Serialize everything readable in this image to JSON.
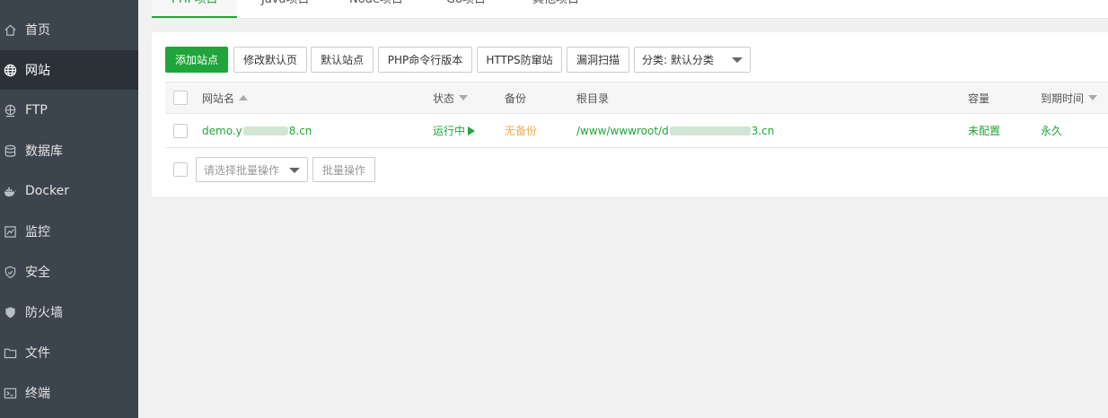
{
  "sidebar": {
    "items": [
      {
        "label": "首页",
        "icon": "home-icon"
      },
      {
        "label": "网站",
        "icon": "globe-icon"
      },
      {
        "label": "FTP",
        "icon": "ftp-icon"
      },
      {
        "label": "数据库",
        "icon": "database-icon"
      },
      {
        "label": "Docker",
        "icon": "docker-icon"
      },
      {
        "label": "监控",
        "icon": "monitor-icon"
      },
      {
        "label": "安全",
        "icon": "shield-check-icon"
      },
      {
        "label": "防火墙",
        "icon": "firewall-icon"
      },
      {
        "label": "文件",
        "icon": "folder-icon"
      },
      {
        "label": "终端",
        "icon": "terminal-icon"
      }
    ],
    "active_index": 1
  },
  "tabs": [
    "PHP项目",
    "Java项目",
    "Node项目",
    "Go项目",
    "其他项目"
  ],
  "toolbar": {
    "add_site": "添加站点",
    "edit_default_page": "修改默认页",
    "default_site": "默认站点",
    "php_cli_version": "PHP命令行版本",
    "https_anti_cross": "HTTPS防窜站",
    "vuln_scan": "漏洞扫描",
    "category_select": "分类: 默认分类"
  },
  "table": {
    "headers": {
      "site_name": "网站名",
      "status": "状态",
      "backup": "备份",
      "root_dir": "根目录",
      "capacity": "容量",
      "expire": "到期时间"
    },
    "rows": [
      {
        "site_prefix": "demo.y",
        "site_suffix": "8.cn",
        "status": "运行中",
        "backup": "无备份",
        "root_prefix": "/www/wwwroot/d",
        "root_suffix": "3.cn",
        "capacity": "未配置",
        "expire": "永久"
      }
    ]
  },
  "batch": {
    "select_placeholder": "请选择批量操作",
    "button": "批量操作"
  },
  "colors": {
    "sidebar_bg": "#3c444d",
    "sidebar_active": "#2c3138",
    "accent_green": "#20a53a",
    "warning_orange": "#f0ad4e"
  }
}
